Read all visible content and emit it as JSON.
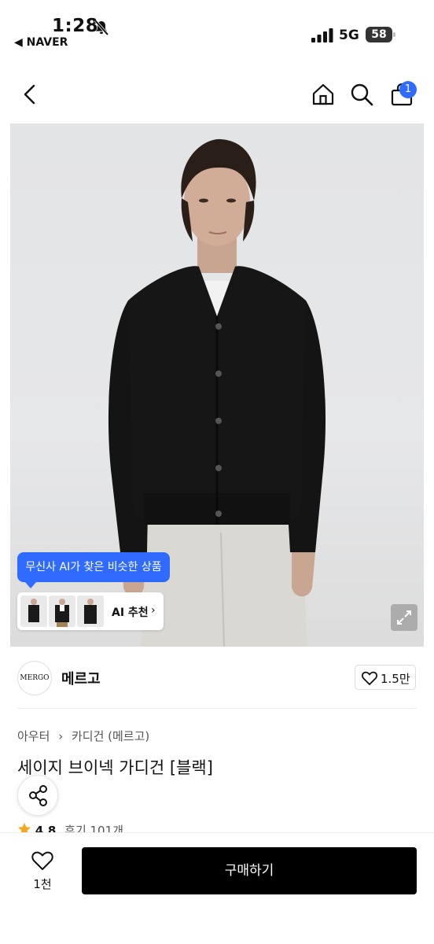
{
  "status_bar": {
    "time": "1:28",
    "back_app": "◀ NAVER",
    "network": "5G",
    "battery": "58"
  },
  "nav": {
    "back_icon": "chevron-left-icon",
    "home_icon": "home-icon",
    "search_icon": "search-icon",
    "cart_icon": "cart-icon",
    "cart_badge": "1"
  },
  "ai_recommend": {
    "bubble_text": "무신사 AI가 찾은 비슷한 상품",
    "label": "AI 추천",
    "chevron": "›"
  },
  "brand": {
    "logo_text": "MERGO",
    "name": "메르고",
    "like_count": "1.5만"
  },
  "product": {
    "breadcrumb": [
      "아우터",
      "카디건 (메르고)"
    ],
    "breadcrumb_sep": "›",
    "title": "세이지 브이넥 가디건 [블랙]",
    "rating": "4.8",
    "reviews": "후기 101개"
  },
  "bottom_bar": {
    "wish_count": "1천",
    "buy_label": "구매하기"
  },
  "colors": {
    "accent": "#2f6bff",
    "buy_button": "#000000",
    "star": "#f5a623"
  }
}
